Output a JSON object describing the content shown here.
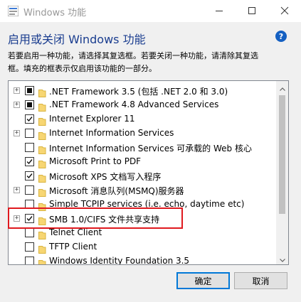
{
  "window": {
    "title": "Windows 功能",
    "minimize_glyph": "—",
    "maximize_glyph": "☐",
    "close_glyph": "✕"
  },
  "header": {
    "heading": "启用或关闭 Windows 功能",
    "help_glyph": "?"
  },
  "description": {
    "line1": "若要启用一种功能，请选择其复选框。若要关闭一种功能，请清除其复选",
    "line2": "框。填充的框表示仅启用该功能的一部分。"
  },
  "features": [
    {
      "label": ".NET Framework 3.5 (包括 .NET 2.0 和 3.0)",
      "state": "partial",
      "expandable": true
    },
    {
      "label": ".NET Framework 4.8 Advanced Services",
      "state": "partial",
      "expandable": true
    },
    {
      "label": "Internet Explorer 11",
      "state": "checked",
      "expandable": false
    },
    {
      "label": "Internet Information Services",
      "state": "unchecked",
      "expandable": true
    },
    {
      "label": "Internet Information Services 可承载的 Web 核心",
      "state": "unchecked",
      "expandable": false
    },
    {
      "label": "Microsoft Print to PDF",
      "state": "checked",
      "expandable": false
    },
    {
      "label": "Microsoft XPS 文档写入程序",
      "state": "checked",
      "expandable": false
    },
    {
      "label": "Microsoft 消息队列(MSMQ)服务器",
      "state": "unchecked",
      "expandable": true
    },
    {
      "label": "Simple TCPIP services (i.e. echo, daytime etc)",
      "state": "unchecked",
      "expandable": false
    },
    {
      "label": "SMB 1.0/CIFS 文件共享支持",
      "state": "checked",
      "expandable": true
    },
    {
      "label": "Telnet Client",
      "state": "unchecked",
      "expandable": false
    },
    {
      "label": "TFTP Client",
      "state": "unchecked",
      "expandable": false
    },
    {
      "label": "Windows Identity Foundation 3.5",
      "state": "unchecked",
      "expandable": false
    }
  ],
  "buttons": {
    "ok": "确定",
    "cancel": "取消"
  },
  "colors": {
    "highlight_border": "#e0191f",
    "heading": "#1a3d8f",
    "folder": "#f7d673"
  }
}
